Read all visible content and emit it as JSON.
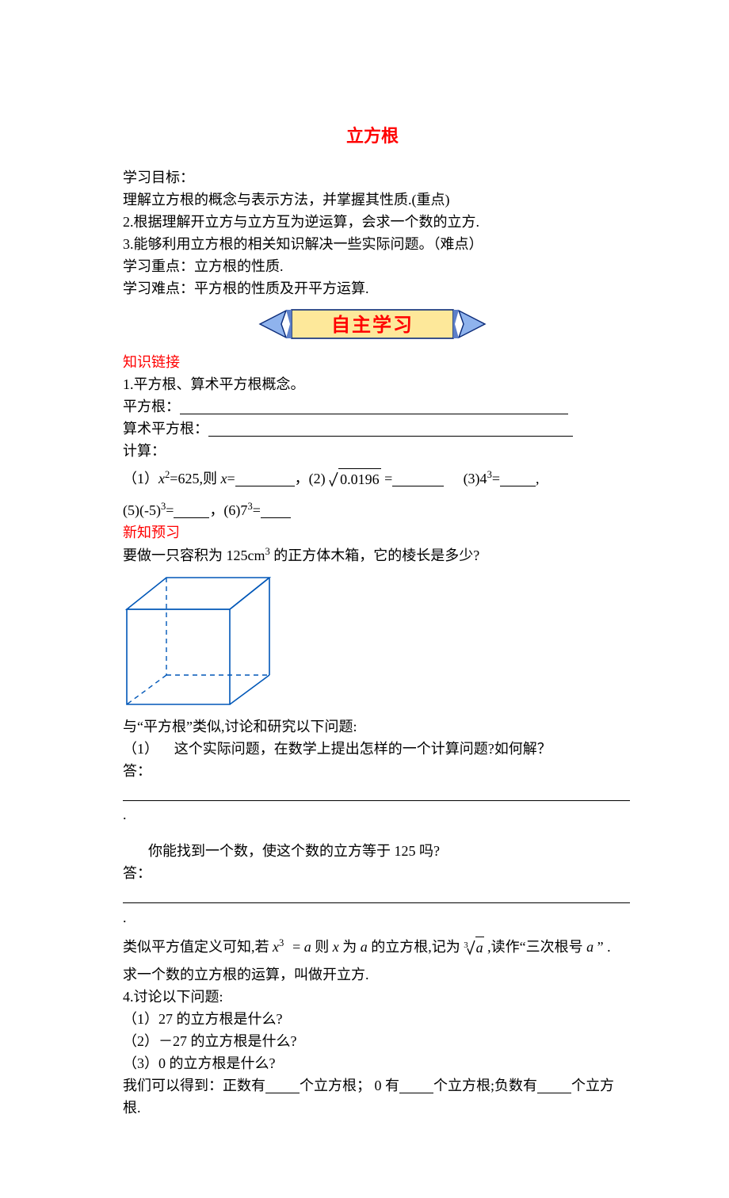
{
  "title": "立方根",
  "study_goals_label": "学习目标：",
  "goals": {
    "g1": "理解立方根的概念与表示方法，并掌握其性质.(重点)",
    "g2": "2.根据理解开立方与立方互为逆运算，会求一个数的立方.",
    "g3": "3.能够利用立方根的相关知识解决一些实际问题。（难点）"
  },
  "focus": "学习重点：立方根的性质.",
  "difficulty": "学习难点：平方根的性质及开平方运算.",
  "banner_text": "自主学习",
  "knowledge_link_label": "知识链接",
  "concept": {
    "line1": "1.平方根、算术平方根概念。",
    "sq_label": "平方根：",
    "arith_label": "算术平方根："
  },
  "calc_label": "计算：",
  "calc": {
    "p1a": "（1）",
    "p1b_val": "=625,则",
    "p1b_eq": "=",
    "p2a": "，(2)",
    "p2b_inner": "0.0196",
    "p2b_after": " =",
    "p3": "(3)4",
    "p3_eq": "=",
    "p5": "(5)(-5)",
    "p5_eq": "=",
    "p6": "，(6)7",
    "p6_eq": "="
  },
  "new_preview_label": "新知预习",
  "preview_q1": "要做一只容积为 125cm",
  "preview_q1b": "的正方体木箱，它的棱长是多少?",
  "discuss_intro": "与“平方根”类似,讨论和研究以下问题:",
  "discuss_q1_label": "（1）",
  "discuss_q1": "这个实际问题，在数学上提出怎样的一个计算问题?如何解？",
  "answer_label": "答：",
  "answer_end": ".",
  "q_find": "你能找到一个数，使这个数的立方等于 125 吗?",
  "analogy": {
    "part1": "类似平方值定义可知,若",
    "part2": "=",
    "a1": "a",
    "part3": " 则",
    "x1": "x",
    "part4": " 为",
    "a2": "a",
    "part5": " 的立方根,记为",
    "part6": ",读作“三次根号",
    "a3": "a",
    "part7": " ”   ."
  },
  "def_open_cube": "求一个数的立方根的运算，叫做开立方.",
  "discuss4": "4.讨论以下问题:",
  "dq1": "（1）27 的立方根是什么?",
  "dq2": "（2）－27 的立方根是什么?",
  "dq3": "（3）0 的立方根是什么?",
  "conclusion": {
    "p1": "我们可以得到：正数有",
    "p2": "个立方根；  0 有",
    "p3": "个立方根;负数有",
    "p4": "个立方根."
  }
}
